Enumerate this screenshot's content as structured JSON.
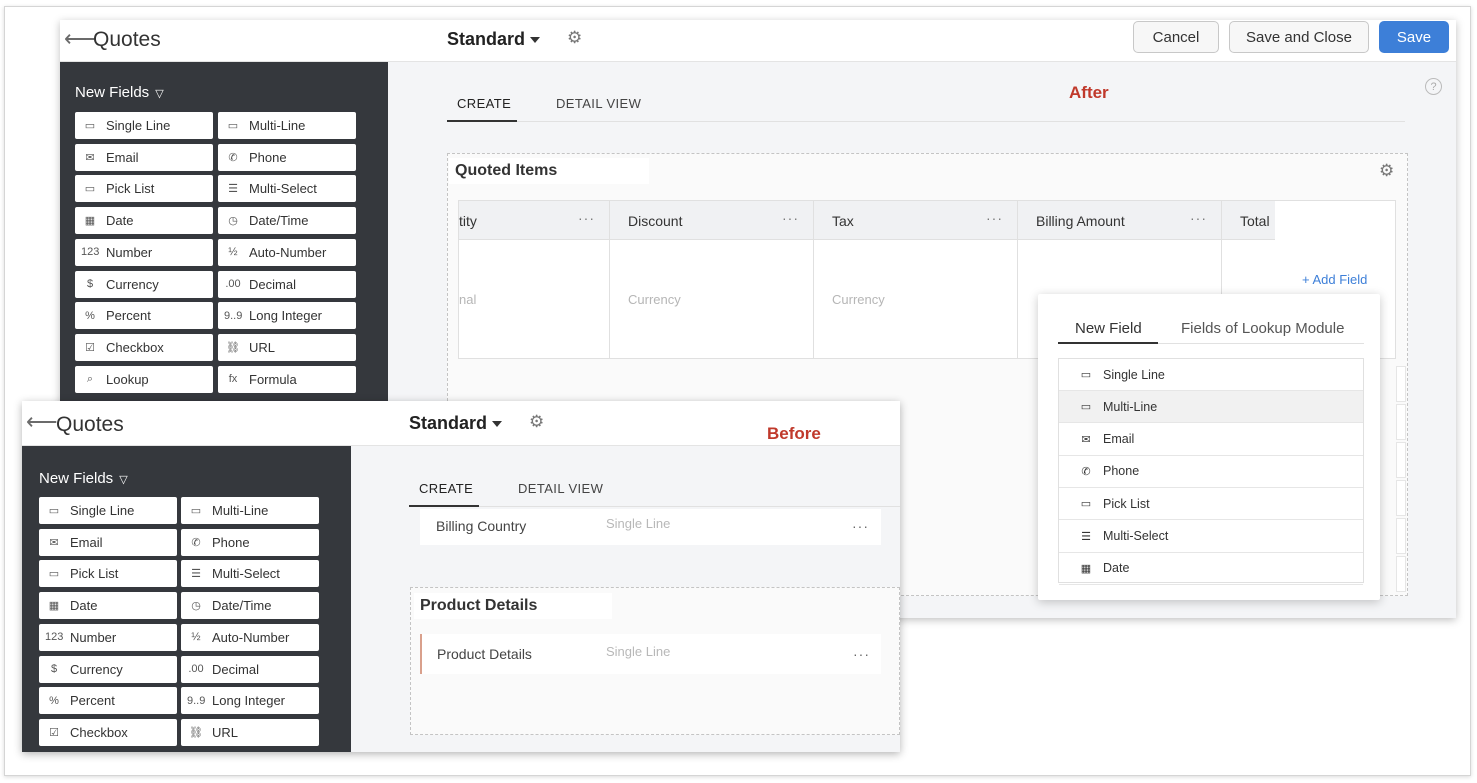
{
  "after": {
    "back_icon": "arrow-left-icon",
    "module_title": "Quotes",
    "layout_name": "Standard",
    "cancel_label": "Cancel",
    "save_close_label": "Save and Close",
    "save_label": "Save",
    "sidebar_title": "New Fields",
    "fields": [
      {
        "label": "Single Line",
        "icon": "▭"
      },
      {
        "label": "Multi-Line",
        "icon": "▭"
      },
      {
        "label": "Email",
        "icon": "✉"
      },
      {
        "label": "Phone",
        "icon": "✆"
      },
      {
        "label": "Pick List",
        "icon": "▭"
      },
      {
        "label": "Multi-Select",
        "icon": "☰"
      },
      {
        "label": "Date",
        "icon": "▦"
      },
      {
        "label": "Date/Time",
        "icon": "◷"
      },
      {
        "label": "Number",
        "icon": "123"
      },
      {
        "label": "Auto-Number",
        "icon": "½"
      },
      {
        "label": "Currency",
        "icon": "$"
      },
      {
        "label": "Decimal",
        "icon": ".00"
      },
      {
        "label": "Percent",
        "icon": "%"
      },
      {
        "label": "Long Integer",
        "icon": "9..9"
      },
      {
        "label": "Checkbox",
        "icon": "☑"
      },
      {
        "label": "URL",
        "icon": "⛓"
      },
      {
        "label": "Lookup",
        "icon": "⌕"
      },
      {
        "label": "Formula",
        "icon": "fx"
      }
    ],
    "tabs": [
      "CREATE",
      "DETAIL VIEW"
    ],
    "tag": "After",
    "help": "?",
    "section_title": "Quoted Items",
    "columns": [
      {
        "label": "tity",
        "cell": "nal"
      },
      {
        "label": "Discount",
        "cell": "Currency"
      },
      {
        "label": "Tax",
        "cell": "Currency"
      },
      {
        "label": "Billing Amount",
        "cell": ""
      },
      {
        "label": "Total",
        "cell": ""
      }
    ],
    "column_menu": "···",
    "add_field": "+ Add Field",
    "popover": {
      "tabs": [
        "New Field",
        "Fields of Lookup Module"
      ],
      "items": [
        {
          "label": "Single Line",
          "icon": "▭"
        },
        {
          "label": "Multi-Line",
          "icon": "▭"
        },
        {
          "label": "Email",
          "icon": "✉"
        },
        {
          "label": "Phone",
          "icon": "✆"
        },
        {
          "label": "Pick List",
          "icon": "▭"
        },
        {
          "label": "Multi-Select",
          "icon": "☰"
        },
        {
          "label": "Date",
          "icon": "▦"
        }
      ]
    }
  },
  "before": {
    "module_title": "Quotes",
    "layout_name": "Standard",
    "tag": "Before",
    "sidebar_title": "New Fields",
    "fields": [
      {
        "label": "Single Line",
        "icon": "▭"
      },
      {
        "label": "Multi-Line",
        "icon": "▭"
      },
      {
        "label": "Email",
        "icon": "✉"
      },
      {
        "label": "Phone",
        "icon": "✆"
      },
      {
        "label": "Pick List",
        "icon": "▭"
      },
      {
        "label": "Multi-Select",
        "icon": "☰"
      },
      {
        "label": "Date",
        "icon": "▦"
      },
      {
        "label": "Date/Time",
        "icon": "◷"
      },
      {
        "label": "Number",
        "icon": "123"
      },
      {
        "label": "Auto-Number",
        "icon": "½"
      },
      {
        "label": "Currency",
        "icon": "$"
      },
      {
        "label": "Decimal",
        "icon": ".00"
      },
      {
        "label": "Percent",
        "icon": "%"
      },
      {
        "label": "Long Integer",
        "icon": "9..9"
      },
      {
        "label": "Checkbox",
        "icon": "☑"
      },
      {
        "label": "URL",
        "icon": "⛓"
      }
    ],
    "tabs": [
      "CREATE",
      "DETAIL VIEW"
    ],
    "billing_row": {
      "label": "Billing Country",
      "type": "Single Line"
    },
    "section_title": "Product Details",
    "product_row": {
      "label": "Product Details",
      "type": "Single Line"
    },
    "row_menu": "···"
  }
}
